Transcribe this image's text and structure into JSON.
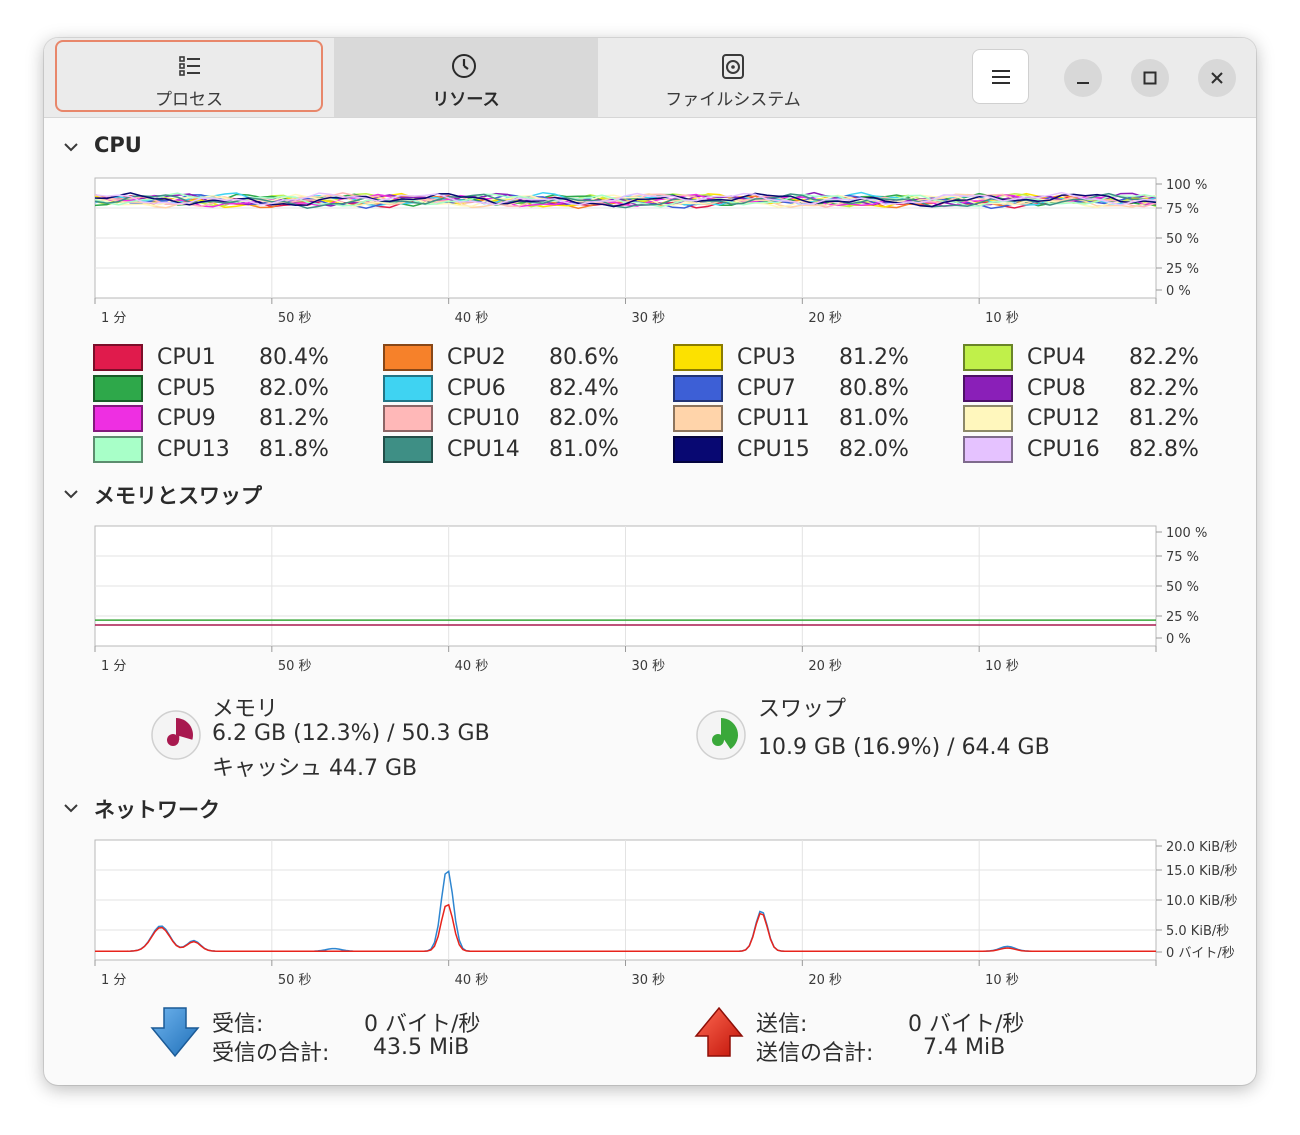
{
  "tabs": [
    {
      "label": "プロセス",
      "icon": "list-icon"
    },
    {
      "label": "リソース",
      "icon": "gauge-icon"
    },
    {
      "label": "ファイルシステム",
      "icon": "disk-icon"
    }
  ],
  "window_buttons": {
    "menu": "hamburger-icon",
    "minimize": "minimize-icon",
    "maximize": "maximize-icon",
    "close": "close-icon"
  },
  "cpu": {
    "title": "CPU",
    "y_ticks": [
      "100 %",
      "75 %",
      "50 %",
      "25 %",
      "0 %"
    ],
    "x_ticks": [
      "1 分",
      "50 秒",
      "40 秒",
      "30 秒",
      "20 秒",
      "10 秒"
    ],
    "cores": [
      {
        "name": "CPU1",
        "value": "80.4%",
        "color": "#e01b4c"
      },
      {
        "name": "CPU2",
        "value": "80.6%",
        "color": "#f6812a"
      },
      {
        "name": "CPU3",
        "value": "81.2%",
        "color": "#fce100"
      },
      {
        "name": "CPU4",
        "value": "82.2%",
        "color": "#c0f04a"
      },
      {
        "name": "CPU5",
        "value": "82.0%",
        "color": "#2ea84a"
      },
      {
        "name": "CPU6",
        "value": "82.4%",
        "color": "#3fd3f2"
      },
      {
        "name": "CPU7",
        "value": "80.8%",
        "color": "#3d5fd6"
      },
      {
        "name": "CPU8",
        "value": "82.2%",
        "color": "#8a1fb8"
      },
      {
        "name": "CPU9",
        "value": "81.2%",
        "color": "#ee2fe2"
      },
      {
        "name": "CPU10",
        "value": "82.0%",
        "color": "#ffb8b8"
      },
      {
        "name": "CPU11",
        "value": "81.0%",
        "color": "#ffd4aa"
      },
      {
        "name": "CPU12",
        "value": "81.2%",
        "color": "#fff7bd"
      },
      {
        "name": "CPU13",
        "value": "81.8%",
        "color": "#a8ffc8"
      },
      {
        "name": "CPU14",
        "value": "81.0%",
        "color": "#3e8f85"
      },
      {
        "name": "CPU15",
        "value": "82.0%",
        "color": "#080872"
      },
      {
        "name": "CPU16",
        "value": "82.8%",
        "color": "#e5c2ff"
      }
    ]
  },
  "memory": {
    "title": "メモリとスワップ",
    "y_ticks": [
      "100 %",
      "75 %",
      "50 %",
      "25 %",
      "0 %"
    ],
    "x_ticks": [
      "1 分",
      "50 秒",
      "40 秒",
      "30 秒",
      "20 秒",
      "10 秒"
    ],
    "memory_label": "メモリ",
    "memory_value": "6.2 GB (12.3%) / 50.3 GB",
    "cache_value": "キャッシュ 44.7 GB",
    "memory_color": "#a8194f",
    "memory_percent": 12.3,
    "swap_label": "スワップ",
    "swap_value": "10.9 GB (16.9%) / 64.4 GB",
    "swap_color": "#3aa83a",
    "swap_percent": 16.9
  },
  "network": {
    "title": "ネットワーク",
    "y_ticks": [
      "20.0 KiB/秒",
      "15.0 KiB/秒",
      "10.0 KiB/秒",
      "5.0 KiB/秒",
      "0 バイト/秒"
    ],
    "x_ticks": [
      "1 分",
      "50 秒",
      "40 秒",
      "30 秒",
      "20 秒",
      "10 秒"
    ],
    "recv_label": "受信:",
    "recv_value": "0 バイト/秒",
    "recv_total_label": "受信の合計:",
    "recv_total_value": "43.5 MiB",
    "recv_color": "#2f86d0",
    "send_label": "送信:",
    "send_value": "0 バイト/秒",
    "send_total_label": "送信の合計:",
    "send_total_value": "7.4 MiB",
    "send_color": "#e8241c"
  }
}
